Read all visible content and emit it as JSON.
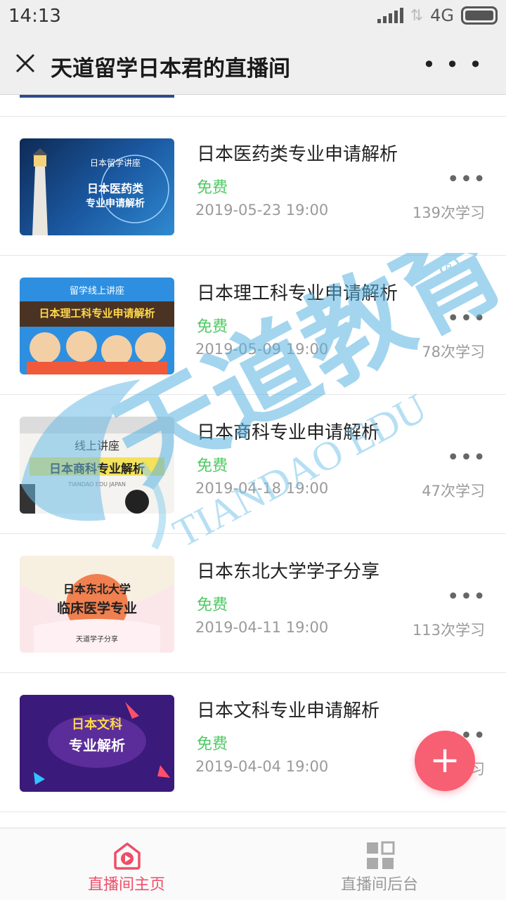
{
  "status": {
    "time": "14:13",
    "network": "4G"
  },
  "header": {
    "title": "天道留学日本君的直播间"
  },
  "items": [
    {
      "name": "日本医药类专业申请解析",
      "price": "免费",
      "date": "2019-05-23 19:00",
      "count": "139次学习",
      "thumb": {
        "line1": "日本留学讲座",
        "line2": "日本医药类",
        "line3": "专业申请解析"
      }
    },
    {
      "name": "日本理工科专业申请解析",
      "price": "免费",
      "date": "2019-05-09 19:00",
      "count": "78次学习",
      "thumb": {
        "line1": "留学线上讲座",
        "line2": "日本理工科专业申请解析"
      }
    },
    {
      "name": "日本商科专业申请解析",
      "price": "免费",
      "date": "2019-04-18 19:00",
      "count": "47次学习",
      "thumb": {
        "line1": "线上讲座",
        "line2": "日本商科专业解析",
        "line3": "TIANDAO EDU JAPAN"
      }
    },
    {
      "name": "日本东北大学学子分享",
      "price": "免费",
      "date": "2019-04-11 19:00",
      "count": "113次学习",
      "thumb": {
        "line1": "日本东北大学",
        "line2": "临床医学专业",
        "line3": "天道学子分享"
      }
    },
    {
      "name": "日本文科专业申请解析",
      "price": "免费",
      "date": "2019-04-04 19:00",
      "count": "9次学习",
      "thumb": {
        "line1": "日本文科",
        "line2": "专业解析"
      }
    }
  ],
  "watermark": {
    "text": "天道教育",
    "sub": "TIANDAO EDU"
  },
  "tabbar": {
    "home": "直播间主页",
    "admin": "直播间后台"
  },
  "colors": {
    "accent": "#ee4f68",
    "free": "#4fc963"
  }
}
